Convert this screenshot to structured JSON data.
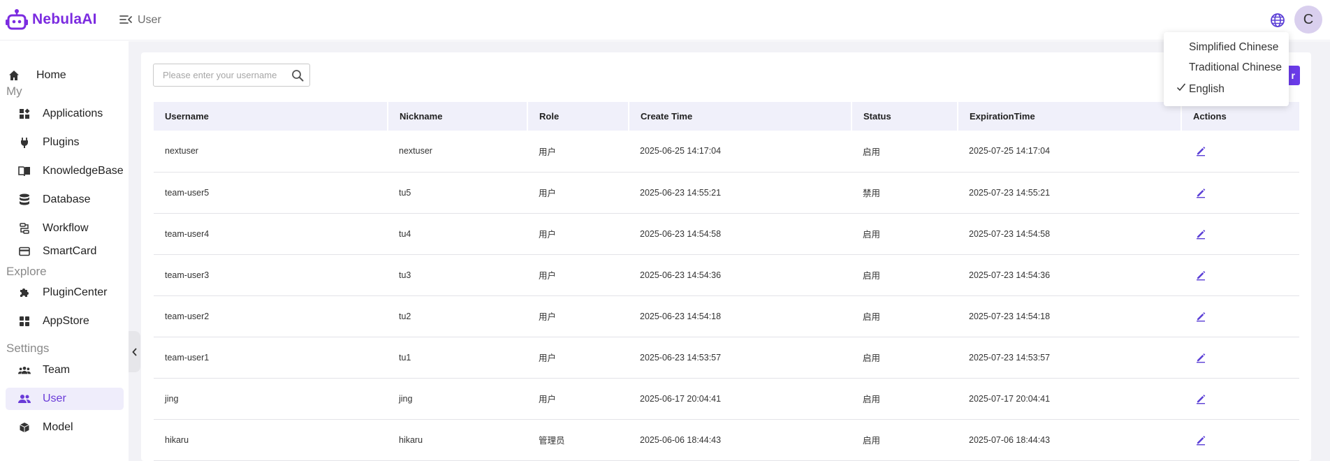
{
  "app": {
    "logo_text": "NebulaAI",
    "brand_color": "#7b2be0",
    "accent_color": "#6a3be8"
  },
  "header": {
    "breadcrumb": "User",
    "avatar_initial": "C"
  },
  "sidebar": {
    "home": "Home",
    "sections": {
      "my": "My",
      "explore": "Explore",
      "settings": "Settings"
    },
    "my_items": [
      "Applications",
      "Plugins",
      "KnowledgeBase",
      "Database",
      "Workflow",
      "SmartCard"
    ],
    "explore_items": [
      "PluginCenter",
      "AppStore"
    ],
    "settings_items": [
      "Team",
      "User",
      "Model"
    ],
    "active": "User"
  },
  "search": {
    "placeholder": "Please enter your username"
  },
  "add_button_label": "r",
  "table": {
    "columns": [
      "Username",
      "Nickname",
      "Role",
      "Create Time",
      "Status",
      "ExpirationTime",
      "Actions"
    ],
    "rows": [
      [
        "nextuser",
        "nextuser",
        "用户",
        "2025-06-25 14:17:04",
        "启用",
        "2025-07-25 14:17:04"
      ],
      [
        "team-user5",
        "tu5",
        "用户",
        "2025-06-23 14:55:21",
        "禁用",
        "2025-07-23 14:55:21"
      ],
      [
        "team-user4",
        "tu4",
        "用户",
        "2025-06-23 14:54:58",
        "启用",
        "2025-07-23 14:54:58"
      ],
      [
        "team-user3",
        "tu3",
        "用户",
        "2025-06-23 14:54:36",
        "启用",
        "2025-07-23 14:54:36"
      ],
      [
        "team-user2",
        "tu2",
        "用户",
        "2025-06-23 14:54:18",
        "启用",
        "2025-07-23 14:54:18"
      ],
      [
        "team-user1",
        "tu1",
        "用户",
        "2025-06-23 14:53:57",
        "启用",
        "2025-07-23 14:53:57"
      ],
      [
        "jing",
        "jing",
        "用户",
        "2025-06-17 20:04:41",
        "启用",
        "2025-07-17 20:04:41"
      ],
      [
        "hikaru",
        "hikaru",
        "管理员",
        "2025-06-06 18:44:43",
        "启用",
        "2025-07-06 18:44:43"
      ]
    ]
  },
  "language_menu": {
    "options": [
      "Simplified Chinese",
      "Traditional Chinese",
      "English"
    ],
    "selected": "English"
  }
}
